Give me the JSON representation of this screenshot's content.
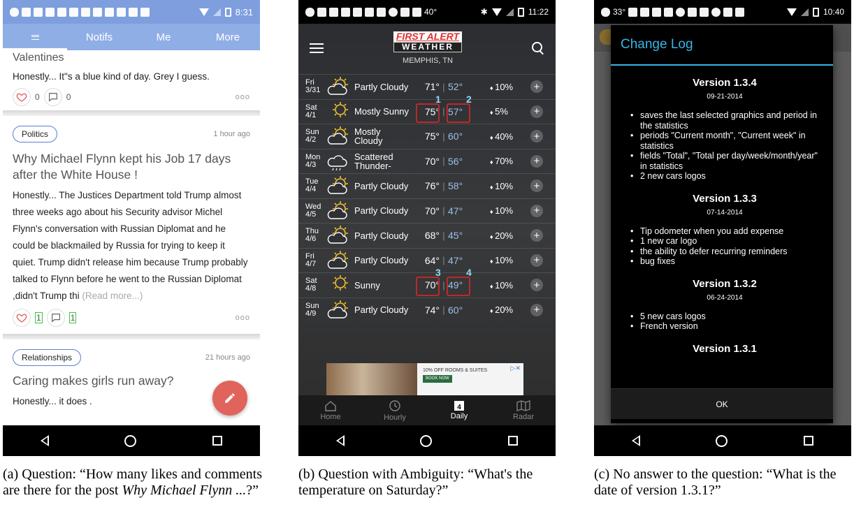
{
  "panel_a": {
    "status_time": "8:31",
    "tabs": [
      "Notifs",
      "Me",
      "More"
    ],
    "post1": {
      "title": "Valentines",
      "body": "Honestly... It\"s a blue kind of day. Grey I guess.",
      "likes": "0",
      "comments": "0"
    },
    "post2": {
      "tag": "Politics",
      "time": "1 hour ago",
      "title": "Why Michael Flynn kept his Job 17 days after the White House !",
      "body": "Honestly... The Justices Department told Trump almost three weeks ago about his Security advisor Michel Flynn's conversation with Russian Diplomat and he could be blackmailed by Russia for trying to keep it quiet. Trump didn't release him because Trump probably talked to Flynn  before he went to the Russian Diplomat ,didn't Trump thi",
      "read_more": "(Read more...)",
      "likes": "1",
      "comments": "1"
    },
    "post3": {
      "tag": "Relationships",
      "time": "21 hours ago",
      "title": "Caring makes girls run away?",
      "body": "Honestly... it does ."
    },
    "more_dots": "ooo"
  },
  "panel_b": {
    "status_time": "11:22",
    "status_temp": "40°",
    "logo_top": "FIRST ALERT",
    "logo_bottom": "WEATHER",
    "city": "MEMPHIS, TN",
    "forecast": [
      {
        "dow": "Fri",
        "date": "3/31",
        "cond": "Partly Cloudy",
        "hi": "71°",
        "lo": "52°",
        "precip": "10%",
        "icon": "partly-cloudy"
      },
      {
        "dow": "Sat",
        "date": "4/1",
        "cond": "Mostly Sunny",
        "hi": "75°",
        "lo": "57°",
        "precip": "5%",
        "icon": "sunny"
      },
      {
        "dow": "Sun",
        "date": "4/2",
        "cond": "Mostly Cloudy",
        "hi": "75°",
        "lo": "60°",
        "precip": "40%",
        "icon": "partly-cloudy"
      },
      {
        "dow": "Mon",
        "date": "4/3",
        "cond": "Scattered Thunder-",
        "hi": "70°",
        "lo": "56°",
        "precip": "70%",
        "icon": "storm"
      },
      {
        "dow": "Tue",
        "date": "4/4",
        "cond": "Partly Cloudy",
        "hi": "76°",
        "lo": "58°",
        "precip": "10%",
        "icon": "partly-cloudy"
      },
      {
        "dow": "Wed",
        "date": "4/5",
        "cond": "Partly Cloudy",
        "hi": "70°",
        "lo": "47°",
        "precip": "10%",
        "icon": "partly-cloudy"
      },
      {
        "dow": "Thu",
        "date": "4/6",
        "cond": "Partly Cloudy",
        "hi": "68°",
        "lo": "45°",
        "precip": "20%",
        "icon": "partly-cloudy"
      },
      {
        "dow": "Fri",
        "date": "4/7",
        "cond": "Partly Cloudy",
        "hi": "64°",
        "lo": "47°",
        "precip": "10%",
        "icon": "partly-cloudy"
      },
      {
        "dow": "Sat",
        "date": "4/8",
        "cond": "Sunny",
        "hi": "70°",
        "lo": "49°",
        "precip": "10%",
        "icon": "sunny"
      },
      {
        "dow": "Sun",
        "date": "4/9",
        "cond": "Partly Cloudy",
        "hi": "74°",
        "lo": "60°",
        "precip": "20%",
        "icon": "partly-cloudy"
      }
    ],
    "marks": [
      "1",
      "2",
      "3",
      "4"
    ],
    "ad_text": "10% OFF ROOMS & SUITES",
    "ad_button": "BOOK NOW",
    "tabs": [
      {
        "label": "Home",
        "icon": "home-icon"
      },
      {
        "label": "Hourly",
        "icon": "clock-icon"
      },
      {
        "label": "Daily",
        "icon": "calendar-icon"
      },
      {
        "label": "Radar",
        "icon": "map-icon"
      }
    ],
    "calendar_day": "4"
  },
  "panel_c": {
    "status_time": "10:40",
    "status_temp": "33°",
    "dialog_title": "Change Log",
    "versions": [
      {
        "version": "Version 1.3.4",
        "date": "09-21-2014",
        "items": [
          "saves the last selected graphics and period in the statistics",
          "periods \"Current month\", \"Current week\" in statistics",
          "fields \"Total\", \"Total per day/week/month/year\" in statistics",
          "2 new cars logos"
        ]
      },
      {
        "version": "Version 1.3.3",
        "date": "07-14-2014",
        "items": [
          "Tip odometer when you add expense",
          "1 new car logo",
          "the ability to defer recurring reminders",
          "bug fixes"
        ]
      },
      {
        "version": "Version 1.3.2",
        "date": "06-24-2014",
        "items": [
          "5 new cars logos",
          "French version"
        ]
      },
      {
        "version": "Version 1.3.1",
        "date": "",
        "items": []
      }
    ],
    "ok_label": "OK"
  },
  "captions": {
    "a_prefix": "(a) Question: “How many likes and comments are there for the post ",
    "a_italic": "Why Michael Flynn ...",
    "a_suffix": "?”",
    "b": "(b) Question with Ambiguity: “What's the temperature on Saturday?”",
    "c": "(c) No answer to the question: “What is the date of version 1.3.1?”"
  },
  "colors": {
    "panel_a_accent": "#90aee6",
    "fab": "#e0635c",
    "highlight_box": "#c02828",
    "highlight_mark": "#8fdcf4",
    "dialog_accent": "#37b5e5"
  }
}
